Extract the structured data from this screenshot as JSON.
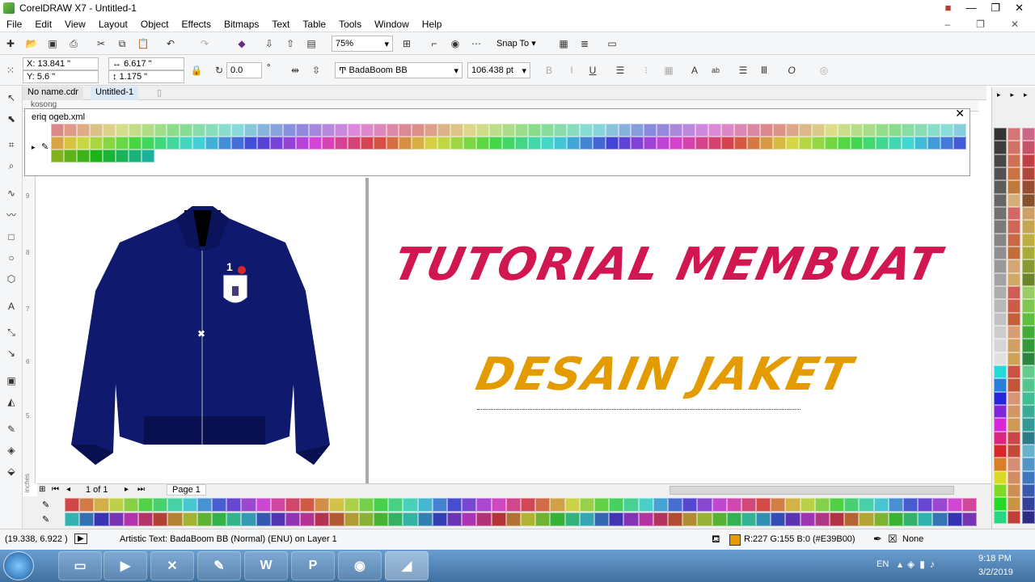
{
  "window": {
    "title": "CorelDRAW X7 - Untitled-1"
  },
  "menu": [
    "File",
    "Edit",
    "View",
    "Layout",
    "Object",
    "Effects",
    "Bitmaps",
    "Text",
    "Table",
    "Tools",
    "Window",
    "Help"
  ],
  "toolbar": {
    "zoom": "75%",
    "snap_label": "Snap To"
  },
  "properties": {
    "x": "X: 13.841 \"",
    "y": "Y: 5.6 \"",
    "width": "6.617 \"",
    "height": "1.175 \"",
    "angle": "0.0",
    "degree": "°",
    "font": "BadaBoom BB",
    "font_size": "106.438 pt"
  },
  "tabs": [
    "No name.cdr",
    "Untitled-1"
  ],
  "ruler": {
    "h_label": "kosong",
    "v_label": "inches",
    "nums": [
      "9",
      "8",
      "7",
      "6",
      "5"
    ]
  },
  "palette_popup": {
    "title": "eriq ogeb.xml"
  },
  "canvas": {
    "headline1": "TUTORIAL MEMBUAT",
    "headline2": "DESAIN JAKET",
    "jacket_badge": "1"
  },
  "nav": {
    "page_count": "1 of 1",
    "page_tab": "Page 1"
  },
  "status": {
    "coords": "(19.338, 6.922 )",
    "object_info": "Artistic Text: BadaBoom BB (Normal) (ENU) on Layer 1",
    "fill": "R:227 G:155 B:0 (#E39B00)",
    "outline": "None"
  },
  "taskbar": {
    "lang": "EN",
    "time": "9:18 PM",
    "date": "3/2/2019",
    "apps": [
      "explorer",
      "media",
      "corel-x",
      "misc",
      "W",
      "P",
      "chrome",
      "corel"
    ]
  },
  "colors": {
    "headline1": "#d0174f",
    "headline2": "#e39b00",
    "jacket": "#0f1a6e",
    "jacket_dark": "#081050"
  }
}
